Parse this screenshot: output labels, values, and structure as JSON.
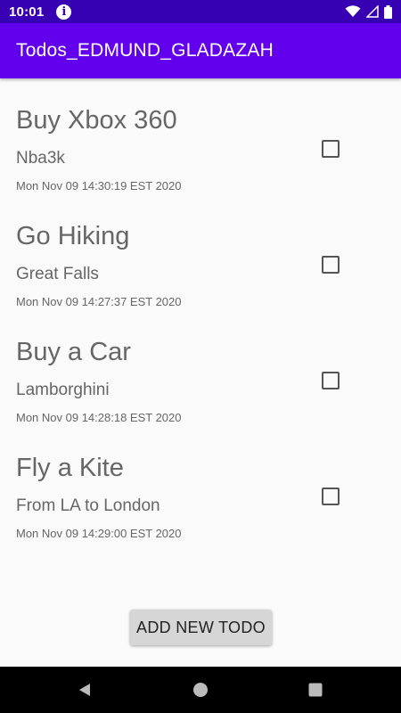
{
  "status_bar": {
    "time": "10:01",
    "icons": [
      "info-icon",
      "wifi-icon",
      "cellular-signal-icon",
      "battery-icon"
    ]
  },
  "app_bar": {
    "title": "Todos_EDMUND_GLADAZAH",
    "color": "#6200ee"
  },
  "todos": [
    {
      "title": "Buy Xbox 360",
      "description": "Nba3k",
      "date": "Mon Nov 09 14:30:19 EST 2020",
      "checked": false
    },
    {
      "title": "Go Hiking",
      "description": "Great Falls",
      "date": "Mon Nov 09 14:27:37 EST 2020",
      "checked": false
    },
    {
      "title": "Buy a Car",
      "description": "Lamborghini",
      "date": "Mon Nov 09 14:28:18 EST 2020",
      "checked": false
    },
    {
      "title": "Fly a Kite",
      "description": "From LA to London",
      "date": "Mon Nov 09 14:29:00 EST 2020",
      "checked": false
    }
  ],
  "add_button": {
    "label": "ADD NEW TODO"
  },
  "nav_bar": {
    "icons": [
      "back-icon",
      "home-icon",
      "recents-icon"
    ]
  },
  "colors": {
    "status_bar": "#3700b3",
    "app_bar": "#6200ee",
    "background": "#fafafa",
    "text": "#666666"
  }
}
